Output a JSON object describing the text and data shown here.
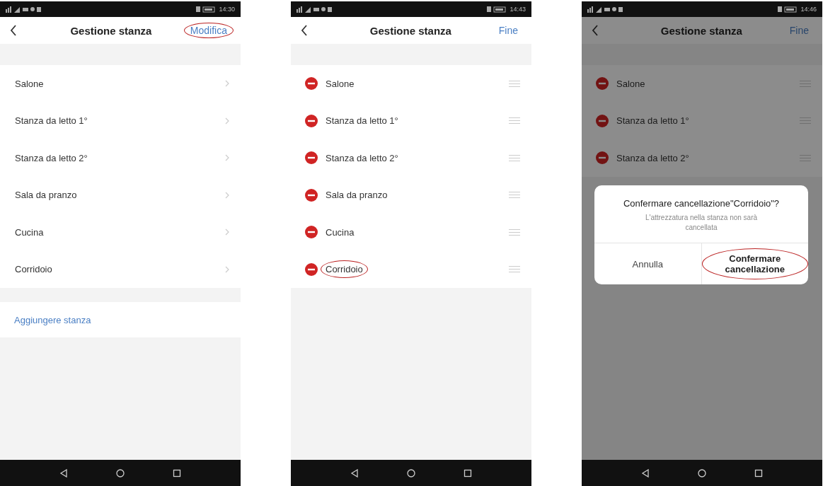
{
  "screens": [
    {
      "kind": "list",
      "dimmed": false,
      "status_time": "14:30",
      "title": "Gestione stanza",
      "action": {
        "label": "Modifica",
        "circled": true
      },
      "rooms": [
        {
          "name": "Salone",
          "circled": false
        },
        {
          "name": "Stanza da letto 1°",
          "circled": false
        },
        {
          "name": "Stanza da letto 2°",
          "circled": false
        },
        {
          "name": "Sala da pranzo",
          "circled": false
        },
        {
          "name": "Cucina",
          "circled": false
        },
        {
          "name": "Corridoio",
          "circled": false
        }
      ],
      "add_label": "Aggiungere stanza"
    },
    {
      "kind": "edit",
      "dimmed": false,
      "status_time": "14:43",
      "title": "Gestione stanza",
      "action": {
        "label": "Fine",
        "circled": false
      },
      "rooms": [
        {
          "name": "Salone",
          "circled": false
        },
        {
          "name": "Stanza da letto 1°",
          "circled": false
        },
        {
          "name": "Stanza da letto 2°",
          "circled": false
        },
        {
          "name": "Sala da pranzo",
          "circled": false
        },
        {
          "name": "Cucina",
          "circled": false
        },
        {
          "name": "Corridoio",
          "circled": true
        }
      ]
    },
    {
      "kind": "edit",
      "dimmed": true,
      "status_time": "14:46",
      "title": "Gestione stanza",
      "action": {
        "label": "Fine",
        "circled": false
      },
      "rooms": [
        {
          "name": "Salone",
          "circled": false
        },
        {
          "name": "Stanza da letto 1°",
          "circled": false
        },
        {
          "name": "Stanza da letto 2°",
          "circled": false
        }
      ],
      "dialog": {
        "title": "Confermare cancellazione\"Corridoio\"?",
        "message": "L'attrezzatura nella stanza non sarà cancellata",
        "buttons": [
          {
            "label": "Annulla",
            "circled": false
          },
          {
            "label": "Confermare cancellazione",
            "circled": true
          }
        ]
      }
    }
  ]
}
